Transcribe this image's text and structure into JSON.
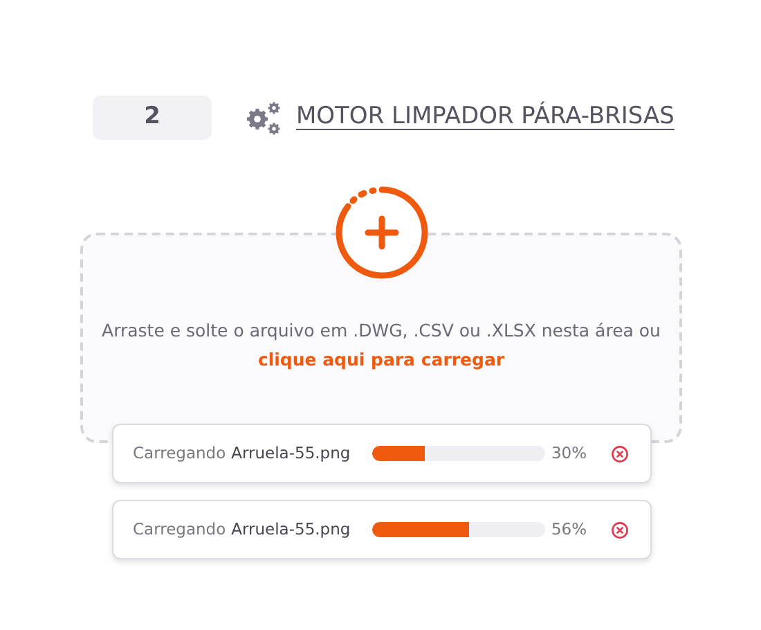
{
  "header": {
    "count": "2",
    "title": "MOTOR LIMPADOR PÁRA-BRISAS"
  },
  "dropzone": {
    "instructions": "Arraste e solte o arquivo em .DWG, .CSV ou .XLSX nesta área ou",
    "link": "clique aqui para carregar"
  },
  "uploads": [
    {
      "prefix": "Carregando",
      "file": "Arruela-55.png",
      "level": 0.3,
      "percent": "30%"
    },
    {
      "prefix": "Carregando",
      "file": "Arruela-55.png",
      "level": 0.56,
      "percent": "56%"
    }
  ]
}
